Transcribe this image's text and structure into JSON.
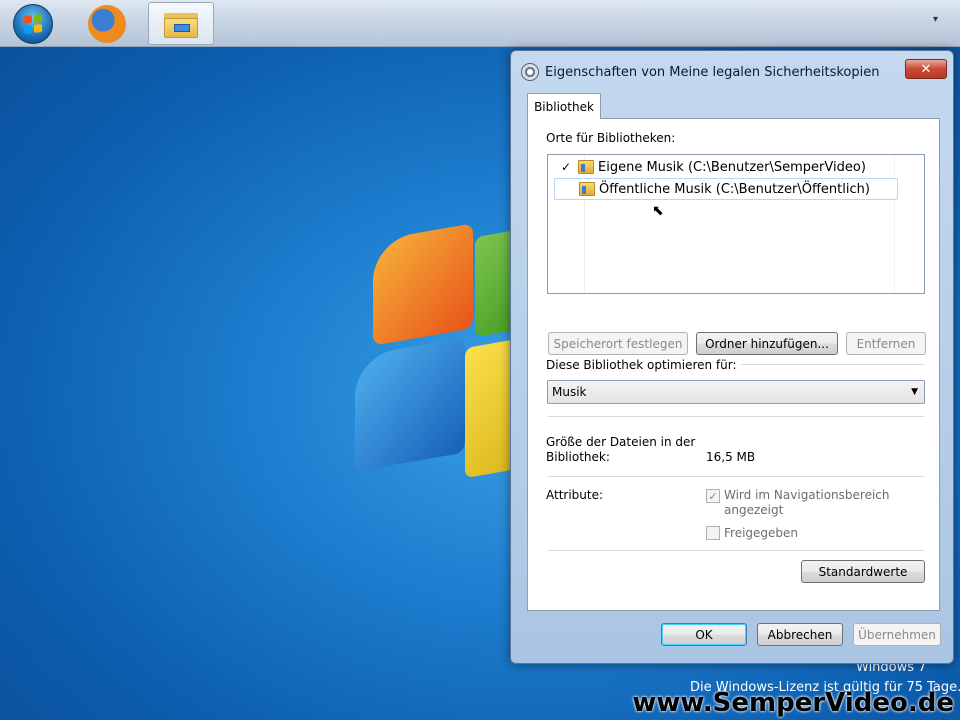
{
  "taskbar": {
    "items": [
      {
        "name": "start-button",
        "icon": "windows-flag-icon"
      },
      {
        "name": "firefox",
        "icon": "firefox-icon"
      },
      {
        "name": "windows-explorer",
        "icon": "folder-icon",
        "active": true
      }
    ],
    "overflow_icon": "▾"
  },
  "desktop": {
    "license_line1": "Windows 7",
    "license_line2": "Die Windows-Lizenz ist gültig für 75 Tage.",
    "watermark": "www.SemperVideo.de"
  },
  "dialog": {
    "title": "Eigenschaften von Meine legalen Sicherheitskopien",
    "close_label": "✕",
    "tab_label": "Bibliothek",
    "locations_label": "Orte für Bibliotheken:",
    "locations": [
      {
        "check": "✓",
        "text": "Eigene Musik (C:\\Benutzer\\SemperVideo)"
      },
      {
        "check": "",
        "text": "Öffentliche Musik (C:\\Benutzer\\Öffentlich)"
      }
    ],
    "buttons": {
      "set_location": "Speicherort festlegen",
      "add_folder": "Ordner hinzufügen...",
      "remove": "Entfernen",
      "restore_defaults": "Standardwerte",
      "ok": "OK",
      "cancel": "Abbrechen",
      "apply": "Übernehmen"
    },
    "optimize_label": "Diese Bibliothek optimieren für:",
    "optimize_value": "Musik",
    "size_label_line1": "Größe der Dateien in der",
    "size_label_line2": "Bibliothek:",
    "size_value": "16,5 MB",
    "attributes_label": "Attribute:",
    "attr_nav_line1": "Wird im Navigationsbereich",
    "attr_nav_line2": "angezeigt",
    "attr_nav_checked": true,
    "attr_shared": "Freigegeben",
    "attr_shared_checked": false
  },
  "colors": {
    "desktop": "#1e7fd0",
    "dialog_frame": "#aac5e3",
    "close": "#c84a35"
  }
}
